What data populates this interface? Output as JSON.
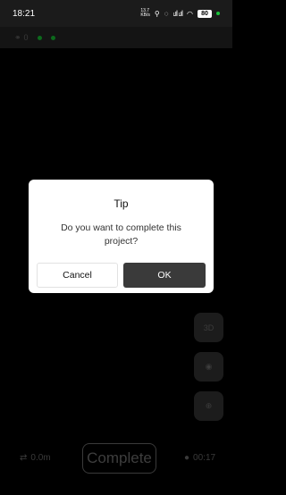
{
  "status_bar": {
    "time": "18:21",
    "net_speed": "13.7\nKB/s",
    "signal": "ₗ.ıl ₗ.ıl",
    "battery": "80"
  },
  "toolbar": {
    "satellite_count": "0"
  },
  "dialog": {
    "title": "Tip",
    "message": "Do you want to complete this project?",
    "cancel_label": "Cancel",
    "ok_label": "OK"
  },
  "side_controls": {
    "view_3d_label": "3D"
  },
  "bottom": {
    "distance": "0.0m",
    "complete_label": "Complete",
    "timer": "00:17"
  },
  "colors": {
    "background": "#000000",
    "status_bar": "#1b1b1b",
    "ok_button": "#3a3a3a",
    "gps_dot": "#0c6a1c"
  }
}
